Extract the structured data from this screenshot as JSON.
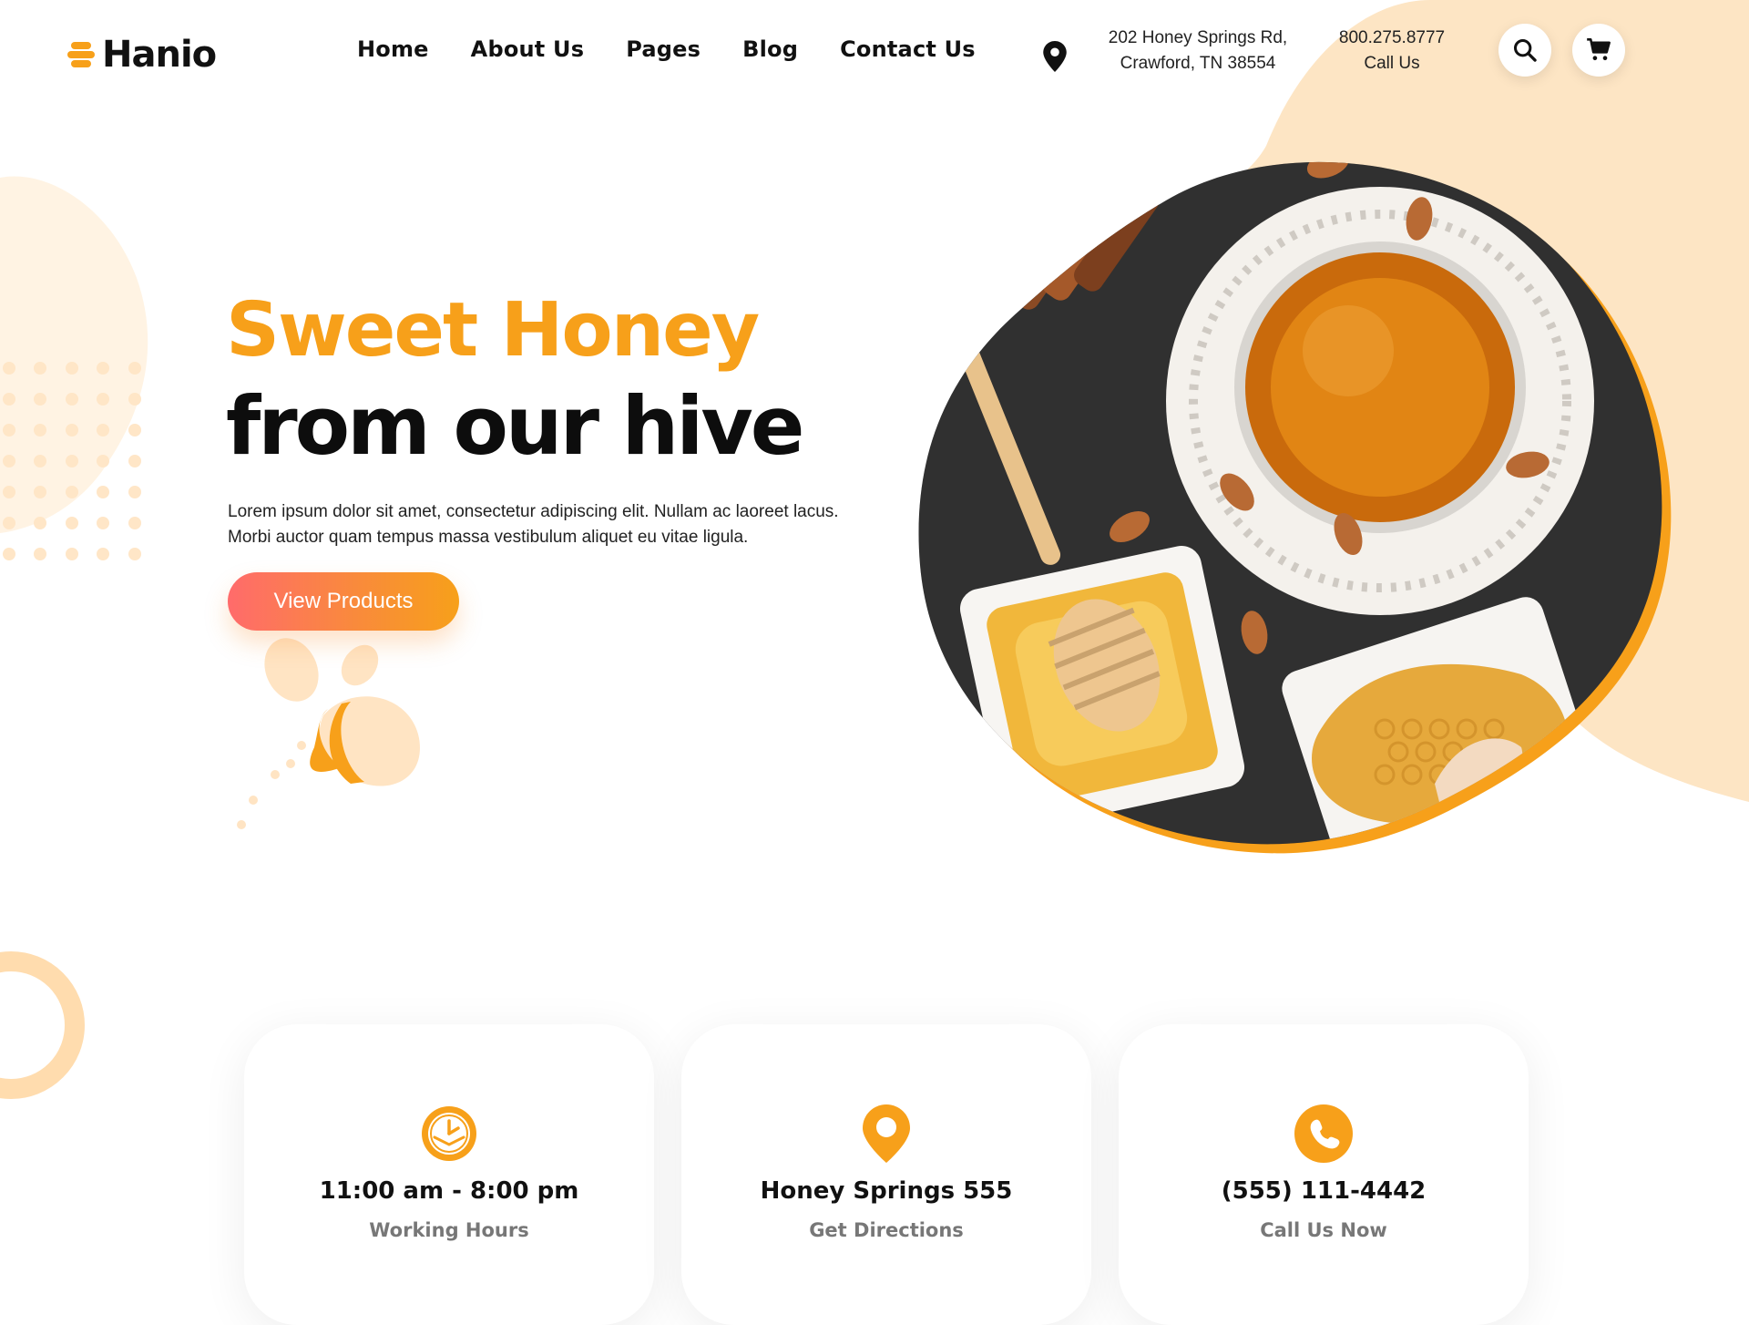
{
  "brand": {
    "name": "Hanio",
    "accent": "#f7a01a",
    "dark": "#111111"
  },
  "nav": [
    {
      "label": "Home"
    },
    {
      "label": "About Us"
    },
    {
      "label": "Pages"
    },
    {
      "label": "Blog"
    },
    {
      "label": "Contact Us"
    }
  ],
  "contact": {
    "address_line1": "202 Honey Springs Rd,",
    "address_line2": "Crawford, TN 38554",
    "phone": "800.275.8777",
    "phone_label": "Call Us"
  },
  "header_icons": {
    "location": "map-pin-icon",
    "search": "search-icon",
    "cart": "cart-icon"
  },
  "hero": {
    "title_line1": "Sweet Honey",
    "title_line2": "from our hive",
    "text_line1": "Lorem ipsum dolor sit amet, consectetur adipiscing elit. Nullam ac laoreet lacus.",
    "text_line2": "Morbi auctor quam tempus massa vestibulum aliquet eu vitae ligula.",
    "cta": "View Products",
    "image": "honey-jar-honeycomb-photo"
  },
  "cards": [
    {
      "icon": "clock-icon",
      "title": "11:00 am - 8:00 pm",
      "subtitle": "Working Hours"
    },
    {
      "icon": "map-pin-icon",
      "title": "Honey Springs 555",
      "subtitle": "Get Directions"
    },
    {
      "icon": "phone-icon",
      "title": "(555) 111-4442",
      "subtitle": "Call Us Now"
    }
  ]
}
